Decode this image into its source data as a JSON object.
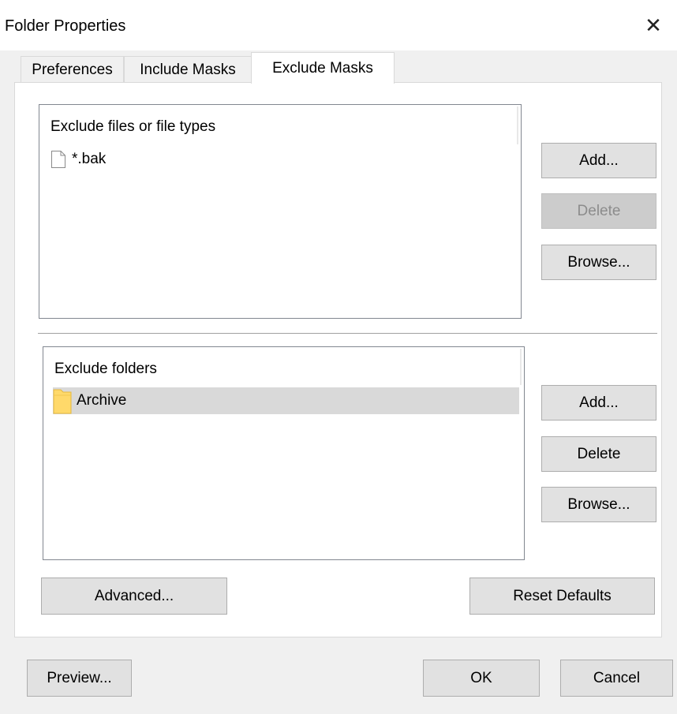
{
  "window": {
    "title": "Folder Properties",
    "close_glyph": "✕"
  },
  "tabs": [
    {
      "label": "Preferences",
      "active": false
    },
    {
      "label": "Include Masks",
      "active": false
    },
    {
      "label": "Exclude Masks",
      "active": true
    }
  ],
  "files_section": {
    "header": "Exclude files or file types",
    "items": [
      {
        "label": "*.bak",
        "icon": "file-icon"
      }
    ],
    "buttons": {
      "add": "Add...",
      "delete": "Delete",
      "browse": "Browse..."
    },
    "delete_disabled": true
  },
  "folders_section": {
    "header": "Exclude folders",
    "items": [
      {
        "label": "Archive",
        "icon": "folder-icon",
        "selected": true
      }
    ],
    "buttons": {
      "add": "Add...",
      "delete": "Delete",
      "browse": "Browse..."
    }
  },
  "panel_buttons": {
    "advanced": "Advanced...",
    "reset_defaults": "Reset Defaults"
  },
  "footer": {
    "preview": "Preview...",
    "ok": "OK",
    "cancel": "Cancel"
  },
  "colors": {
    "selected_row": "#d9d9d9",
    "folder": "#ffd96a",
    "button_face": "#e1e1e1"
  }
}
